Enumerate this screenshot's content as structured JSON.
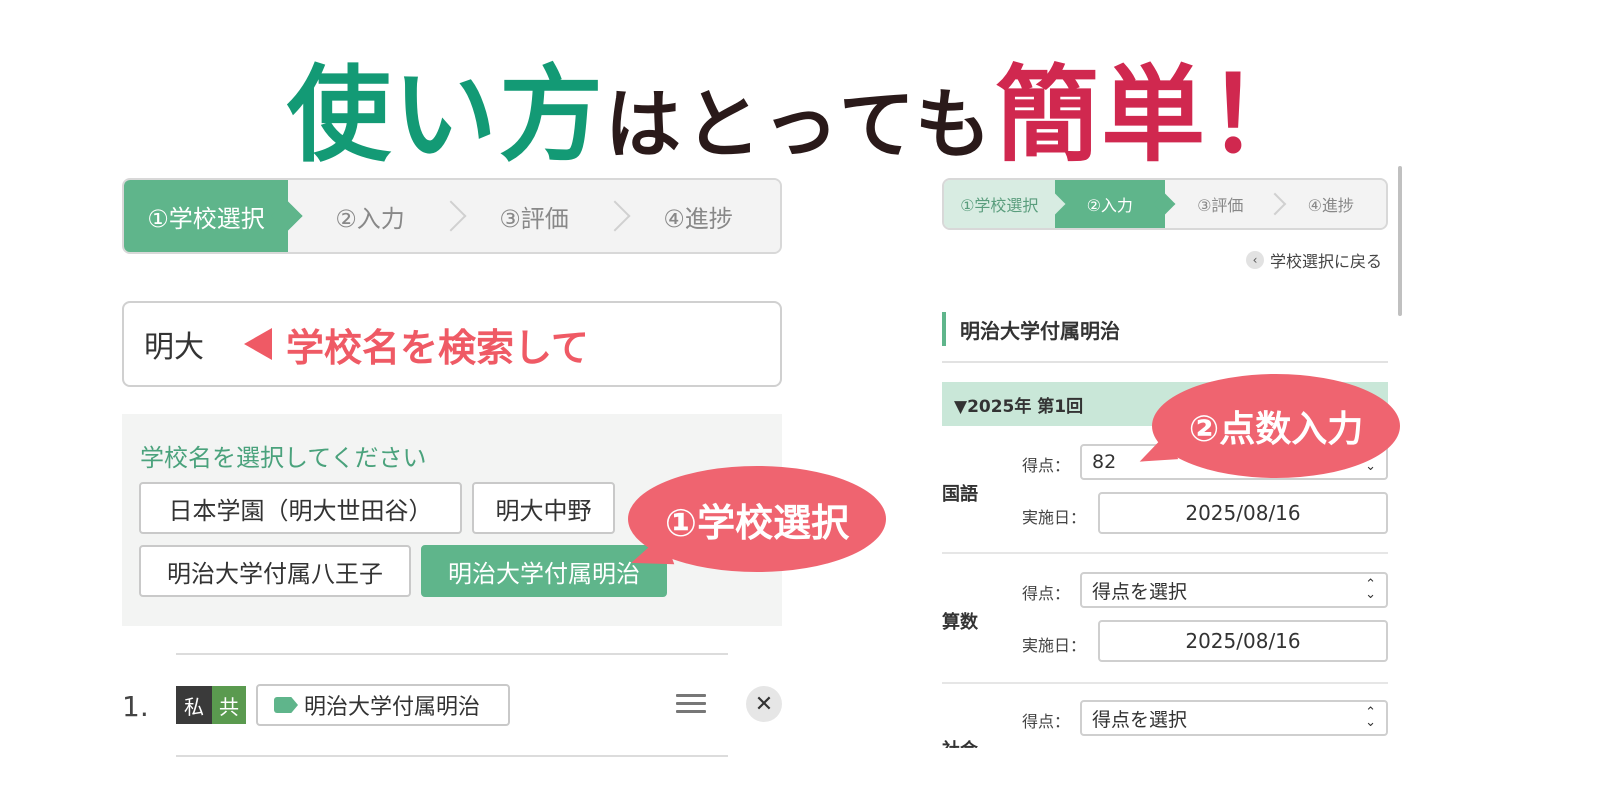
{
  "headline": {
    "part1": "使い方",
    "part2": "はとっても",
    "part3": "簡単！"
  },
  "colors": {
    "green": "#139a75",
    "accent_green": "#5fb58b",
    "red": "#d0284f",
    "coral": "#ef6470"
  },
  "left_stepper": {
    "steps": [
      "①学校選択",
      "②入力",
      "③評価",
      "④進捗"
    ],
    "active_index": 0
  },
  "search": {
    "value": "明大",
    "hint": "学校名を検索して"
  },
  "select_panel": {
    "title": "学校名を選択してください",
    "options": [
      "日本学園（明大世田谷）",
      "明大中野",
      "明治大学付属八王子",
      "明治大学付属明治"
    ],
    "selected": "明治大学付属明治"
  },
  "callouts": {
    "school_select": "①学校選択",
    "score_input": "②点数入力"
  },
  "list": {
    "number": "1.",
    "tag_private": "私",
    "tag_coed": "共",
    "school": "明治大学付属明治"
  },
  "right_panel": {
    "steps": [
      "①学校選択",
      "②入力",
      "③評価",
      "④進捗"
    ],
    "active_index": 1,
    "back_link": "学校選択に戻る",
    "school_title": "明治大学付属明治",
    "exam_header": "▼2025年 第1回",
    "score_label": "得点：",
    "date_label": "実施日：",
    "subjects": [
      {
        "name": "国語",
        "score": "82",
        "date": "2025/08/16"
      },
      {
        "name": "算数",
        "score": "得点を選択",
        "date": "2025/08/16"
      },
      {
        "name": "社会",
        "score": "得点を選択"
      }
    ]
  }
}
